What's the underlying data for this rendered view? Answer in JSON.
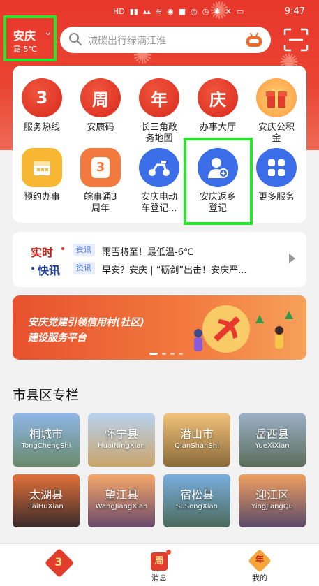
{
  "status": {
    "time": "9:47",
    "icons": [
      "HD",
      "5G",
      "signal",
      "wifi",
      "qq",
      "app",
      "battery"
    ]
  },
  "header": {
    "city": "安庆",
    "weather": "霜 5℃",
    "search_placeholder": "减碳出行绿满江淮",
    "accent": "#e8372c"
  },
  "services": [
    {
      "label": "服务热线",
      "glyph": "3",
      "style": "red"
    },
    {
      "label": "安康码",
      "glyph": "周",
      "style": "red"
    },
    {
      "label": "长三角政\n务地图",
      "glyph": "年",
      "style": "red"
    },
    {
      "label": "办事大厅",
      "glyph": "庆",
      "style": "red"
    },
    {
      "label": "安庆公积\n金",
      "glyph": "gift-icon",
      "style": "gift"
    },
    {
      "label": "预约办事",
      "glyph": "calendar-icon",
      "style": "yellow"
    },
    {
      "label": "皖事通3\n周年",
      "glyph": "3",
      "style": "orange"
    },
    {
      "label": "安庆电动\n车登记...",
      "glyph": "scooter-icon",
      "style": "blue"
    },
    {
      "label": "安庆返乡\n登记",
      "glyph": "person-icon",
      "style": "blue"
    },
    {
      "label": "更多服务",
      "glyph": "grid-icon",
      "style": "blue"
    }
  ],
  "news": {
    "brand_line1": "实时",
    "brand_line2": "快讯",
    "items": [
      {
        "tag": "资讯",
        "text": "雨雪将至！最低温-6℃"
      },
      {
        "tag": "资讯",
        "text": "早安？安庆 | “砺剑”出击！安庆严..."
      }
    ]
  },
  "banner": {
    "line1": "安庆党建引领信用村(社区)",
    "line2": "建设服务平台"
  },
  "section": {
    "title": "市县区专栏"
  },
  "tiles": [
    {
      "name": "桐城市",
      "pinyin": "TongChengShi",
      "bg": "linear-gradient(180deg,#8fb6e8,#6a8a6a)"
    },
    {
      "name": "怀宁县",
      "pinyin": "HuaiNingXian",
      "bg": "linear-gradient(180deg,#b8d2ee,#c9a46a)"
    },
    {
      "name": "潜山市",
      "pinyin": "QianShanShi",
      "bg": "linear-gradient(180deg,#f1c27a,#8a6a3a)"
    },
    {
      "name": "岳西县",
      "pinyin": "YueXiXian",
      "bg": "linear-gradient(180deg,#9bb0c7,#5b6d5b)"
    },
    {
      "name": "太湖县",
      "pinyin": "TaiHuXian",
      "bg": "linear-gradient(180deg,#e2713a,#3a2a2a)"
    },
    {
      "name": "望江县",
      "pinyin": "WangJiangXian",
      "bg": "linear-gradient(180deg,#f6a86a,#6a4a6a)"
    },
    {
      "name": "宿松县",
      "pinyin": "SuSongXian",
      "bg": "linear-gradient(180deg,#7aaee0,#4a6a5a)"
    },
    {
      "name": "迎江区",
      "pinyin": "YingJiangQu",
      "bg": "linear-gradient(180deg,#f0a060,#5a4a6a)"
    }
  ],
  "bottom_nav": {
    "home_glyph": "3",
    "msg_label": "消息",
    "msg_glyph": "周",
    "me_label": "我的",
    "me_glyph": "年"
  }
}
